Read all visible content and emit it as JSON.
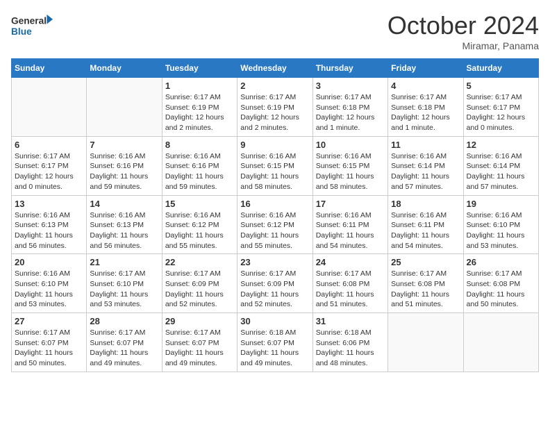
{
  "logo": {
    "line1": "General",
    "line2": "Blue"
  },
  "title": "October 2024",
  "subtitle": "Miramar, Panama",
  "days_of_week": [
    "Sunday",
    "Monday",
    "Tuesday",
    "Wednesday",
    "Thursday",
    "Friday",
    "Saturday"
  ],
  "weeks": [
    [
      {
        "day": "",
        "content": ""
      },
      {
        "day": "",
        "content": ""
      },
      {
        "day": "1",
        "content": "Sunrise: 6:17 AM\nSunset: 6:19 PM\nDaylight: 12 hours and 2 minutes."
      },
      {
        "day": "2",
        "content": "Sunrise: 6:17 AM\nSunset: 6:19 PM\nDaylight: 12 hours and 2 minutes."
      },
      {
        "day": "3",
        "content": "Sunrise: 6:17 AM\nSunset: 6:18 PM\nDaylight: 12 hours and 1 minute."
      },
      {
        "day": "4",
        "content": "Sunrise: 6:17 AM\nSunset: 6:18 PM\nDaylight: 12 hours and 1 minute."
      },
      {
        "day": "5",
        "content": "Sunrise: 6:17 AM\nSunset: 6:17 PM\nDaylight: 12 hours and 0 minutes."
      }
    ],
    [
      {
        "day": "6",
        "content": "Sunrise: 6:17 AM\nSunset: 6:17 PM\nDaylight: 12 hours and 0 minutes."
      },
      {
        "day": "7",
        "content": "Sunrise: 6:16 AM\nSunset: 6:16 PM\nDaylight: 11 hours and 59 minutes."
      },
      {
        "day": "8",
        "content": "Sunrise: 6:16 AM\nSunset: 6:16 PM\nDaylight: 11 hours and 59 minutes."
      },
      {
        "day": "9",
        "content": "Sunrise: 6:16 AM\nSunset: 6:15 PM\nDaylight: 11 hours and 58 minutes."
      },
      {
        "day": "10",
        "content": "Sunrise: 6:16 AM\nSunset: 6:15 PM\nDaylight: 11 hours and 58 minutes."
      },
      {
        "day": "11",
        "content": "Sunrise: 6:16 AM\nSunset: 6:14 PM\nDaylight: 11 hours and 57 minutes."
      },
      {
        "day": "12",
        "content": "Sunrise: 6:16 AM\nSunset: 6:14 PM\nDaylight: 11 hours and 57 minutes."
      }
    ],
    [
      {
        "day": "13",
        "content": "Sunrise: 6:16 AM\nSunset: 6:13 PM\nDaylight: 11 hours and 56 minutes."
      },
      {
        "day": "14",
        "content": "Sunrise: 6:16 AM\nSunset: 6:13 PM\nDaylight: 11 hours and 56 minutes."
      },
      {
        "day": "15",
        "content": "Sunrise: 6:16 AM\nSunset: 6:12 PM\nDaylight: 11 hours and 55 minutes."
      },
      {
        "day": "16",
        "content": "Sunrise: 6:16 AM\nSunset: 6:12 PM\nDaylight: 11 hours and 55 minutes."
      },
      {
        "day": "17",
        "content": "Sunrise: 6:16 AM\nSunset: 6:11 PM\nDaylight: 11 hours and 54 minutes."
      },
      {
        "day": "18",
        "content": "Sunrise: 6:16 AM\nSunset: 6:11 PM\nDaylight: 11 hours and 54 minutes."
      },
      {
        "day": "19",
        "content": "Sunrise: 6:16 AM\nSunset: 6:10 PM\nDaylight: 11 hours and 53 minutes."
      }
    ],
    [
      {
        "day": "20",
        "content": "Sunrise: 6:16 AM\nSunset: 6:10 PM\nDaylight: 11 hours and 53 minutes."
      },
      {
        "day": "21",
        "content": "Sunrise: 6:17 AM\nSunset: 6:10 PM\nDaylight: 11 hours and 53 minutes."
      },
      {
        "day": "22",
        "content": "Sunrise: 6:17 AM\nSunset: 6:09 PM\nDaylight: 11 hours and 52 minutes."
      },
      {
        "day": "23",
        "content": "Sunrise: 6:17 AM\nSunset: 6:09 PM\nDaylight: 11 hours and 52 minutes."
      },
      {
        "day": "24",
        "content": "Sunrise: 6:17 AM\nSunset: 6:08 PM\nDaylight: 11 hours and 51 minutes."
      },
      {
        "day": "25",
        "content": "Sunrise: 6:17 AM\nSunset: 6:08 PM\nDaylight: 11 hours and 51 minutes."
      },
      {
        "day": "26",
        "content": "Sunrise: 6:17 AM\nSunset: 6:08 PM\nDaylight: 11 hours and 50 minutes."
      }
    ],
    [
      {
        "day": "27",
        "content": "Sunrise: 6:17 AM\nSunset: 6:07 PM\nDaylight: 11 hours and 50 minutes."
      },
      {
        "day": "28",
        "content": "Sunrise: 6:17 AM\nSunset: 6:07 PM\nDaylight: 11 hours and 49 minutes."
      },
      {
        "day": "29",
        "content": "Sunrise: 6:17 AM\nSunset: 6:07 PM\nDaylight: 11 hours and 49 minutes."
      },
      {
        "day": "30",
        "content": "Sunrise: 6:18 AM\nSunset: 6:07 PM\nDaylight: 11 hours and 49 minutes."
      },
      {
        "day": "31",
        "content": "Sunrise: 6:18 AM\nSunset: 6:06 PM\nDaylight: 11 hours and 48 minutes."
      },
      {
        "day": "",
        "content": ""
      },
      {
        "day": "",
        "content": ""
      }
    ]
  ]
}
